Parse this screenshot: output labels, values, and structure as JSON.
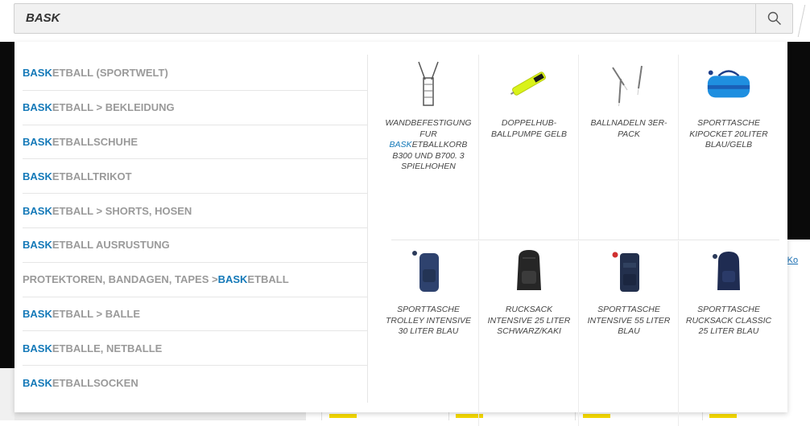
{
  "search": {
    "value": "BASK",
    "search_icon": "search-icon"
  },
  "background": {
    "link_text": "-Ko"
  },
  "suggestions": [
    {
      "pre": "",
      "hl": "BASK",
      "rest": "ETBALL (SPORTWELT)"
    },
    {
      "pre": "",
      "hl": "BASK",
      "rest": "ETBALL > BEKLEIDUNG"
    },
    {
      "pre": "",
      "hl": "BASK",
      "rest": "ETBALLSCHUHE"
    },
    {
      "pre": "",
      "hl": "BASK",
      "rest": "ETBALLTRIKOT"
    },
    {
      "pre": "",
      "hl": "BASK",
      "rest": "ETBALL > SHORTS, HOSEN"
    },
    {
      "pre": "",
      "hl": "BASK",
      "rest": "ETBALL AUSRUSTUNG"
    },
    {
      "pre": "PROTEKTOREN, BANDAGEN, TAPES > ",
      "hl": "BASK",
      "rest": "ETBALL"
    },
    {
      "pre": "",
      "hl": "BASK",
      "rest": "ETBALL > BALLE"
    },
    {
      "pre": "",
      "hl": "BASK",
      "rest": "ETBALLE, NETBALLE"
    },
    {
      "pre": "",
      "hl": "BASK",
      "rest": "ETBALLSOCKEN"
    }
  ],
  "products": [
    {
      "icon": "wall-mount-icon",
      "pre": "WANDBEFESTIGUNG FUR ",
      "hl": "BASK",
      "rest": "ETBALLKORB B300 UND B700. 3 SPIELHOHEN"
    },
    {
      "icon": "ball-pump-icon",
      "pre": "DOPPELHUB-BALLPUMPE GELB",
      "hl": "",
      "rest": ""
    },
    {
      "icon": "ball-needles-icon",
      "pre": "BALLNADELN 3ER-PACK",
      "hl": "",
      "rest": ""
    },
    {
      "icon": "sports-bag-icon",
      "pre": "SPORTTASCHE KIPOCKET 20LITER BLAU/GELB",
      "hl": "",
      "rest": ""
    },
    {
      "icon": "trolley-bag-icon",
      "pre": "SPORTTASCHE TROLLEY INTENSIVE 30 LITER BLAU",
      "hl": "",
      "rest": ""
    },
    {
      "icon": "backpack-black-icon",
      "pre": "RUCKSACK INTENSIVE 25 LITER SCHWARZ/KAKI",
      "hl": "",
      "rest": ""
    },
    {
      "icon": "duffel-backpack-icon",
      "pre": "SPORTTASCHE INTENSIVE 55 LITER BLAU",
      "hl": "",
      "rest": ""
    },
    {
      "icon": "backpack-navy-icon",
      "pre": "SPORTTASCHE RUCKSACK CLASSIC 25 LITER BLAU",
      "hl": "",
      "rest": ""
    }
  ],
  "colors": {
    "highlight": "#1479b8",
    "suggestion_text": "#9a9a9a",
    "accent_yellow": "#f4d800"
  }
}
